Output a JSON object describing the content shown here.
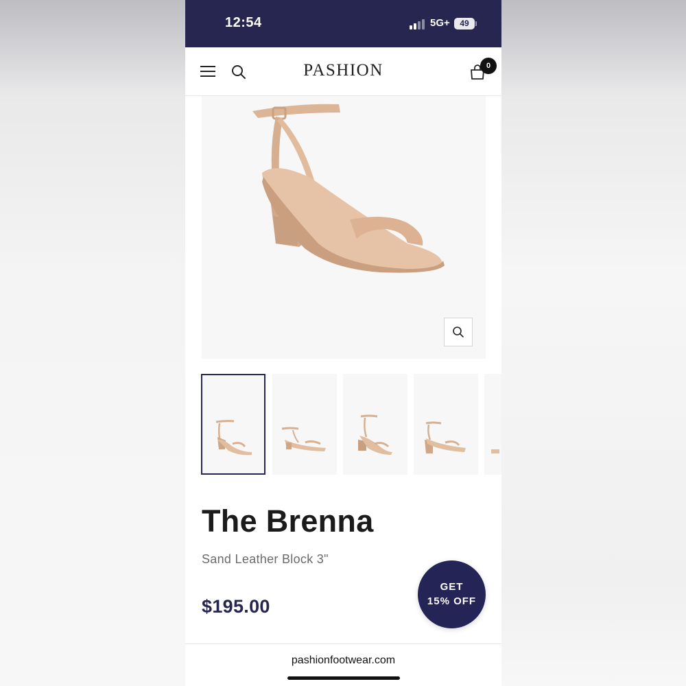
{
  "status_bar": {
    "time": "12:54",
    "network": "5G+",
    "battery": "49",
    "background_color": "#262650"
  },
  "header": {
    "brand": "PASHION",
    "cart_count": "0",
    "icons": [
      "menu-icon",
      "search-icon",
      "cart-icon"
    ]
  },
  "gallery": {
    "thumbnail_count": 5,
    "selected_index": 0,
    "zoom_icon": "zoom-icon"
  },
  "product": {
    "name": "The Brenna",
    "variant": "Sand Leather Block 3\"",
    "price": "$195.00"
  },
  "promo": {
    "line1": "GET",
    "line2": "15% OFF",
    "color": "#242456"
  },
  "browser": {
    "url": "pashionfootwear.com"
  },
  "colors": {
    "accent": "#262650",
    "sandal": "#dfb799"
  }
}
